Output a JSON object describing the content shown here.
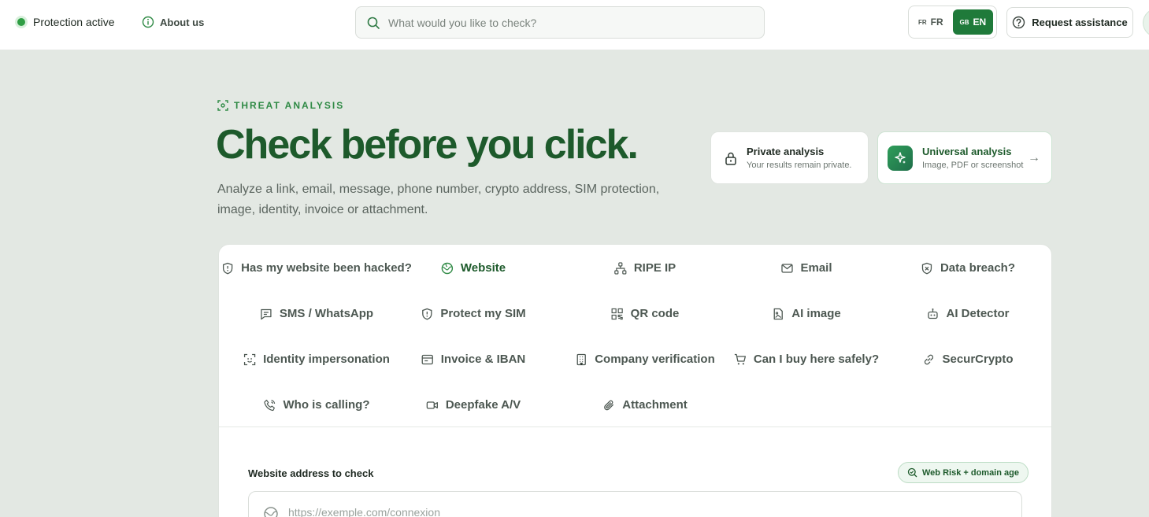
{
  "header": {
    "status_label": "Protection active",
    "about_label": "About us",
    "search_placeholder": "What would you like to check?",
    "lang_fr_flag": "FR",
    "lang_fr": "FR",
    "lang_en_flag": "GB",
    "lang_en": "EN",
    "assist_label": "Request assistance"
  },
  "hero": {
    "kicker": "THREAT ANALYSIS",
    "title": "Check before you click.",
    "subtitle": "Analyze a link, email, message, phone number, crypto address, SIM protection, image, identity, invoice or attachment."
  },
  "cards": {
    "private_title": "Private analysis",
    "private_sub": "Your results remain private.",
    "universal_title": "Universal analysis",
    "universal_sub": "Image, PDF or screenshot",
    "arrow": "→"
  },
  "tools": [
    {
      "label": "Has my website been hacked?",
      "icon": "shield-icon"
    },
    {
      "label": "Website",
      "icon": "globe-icon"
    },
    {
      "label": "RIPE IP",
      "icon": "network-icon"
    },
    {
      "label": "Email",
      "icon": "mail-icon"
    },
    {
      "label": "Data breach?",
      "icon": "shield-x-icon"
    },
    {
      "label": "SMS / WhatsApp",
      "icon": "message-icon"
    },
    {
      "label": "Protect my SIM",
      "icon": "shield-icon"
    },
    {
      "label": "QR code",
      "icon": "qr-icon"
    },
    {
      "label": "AI image",
      "icon": "image-file-icon"
    },
    {
      "label": "AI Detector",
      "icon": "robot-icon"
    },
    {
      "label": "Identity impersonation",
      "icon": "scan-face-icon"
    },
    {
      "label": "Invoice & IBAN",
      "icon": "invoice-icon"
    },
    {
      "label": "Company verification",
      "icon": "building-icon"
    },
    {
      "label": "Can I buy here safely?",
      "icon": "cart-icon"
    },
    {
      "label": "SecurCrypto",
      "icon": "link-icon"
    },
    {
      "label": "Who is calling?",
      "icon": "phone-icon"
    },
    {
      "label": "Deepfake A/V",
      "icon": "video-icon"
    },
    {
      "label": "Attachment",
      "icon": "paperclip-icon"
    }
  ],
  "active_tool": "Website",
  "form": {
    "label": "Website address to check",
    "badge": "Web Risk + domain age",
    "placeholder": "https://exemple.com/connexion"
  },
  "colors": {
    "brand_green": "#1d5a2b",
    "accent_green": "#2f9e44",
    "background": "#e3e8e3"
  }
}
